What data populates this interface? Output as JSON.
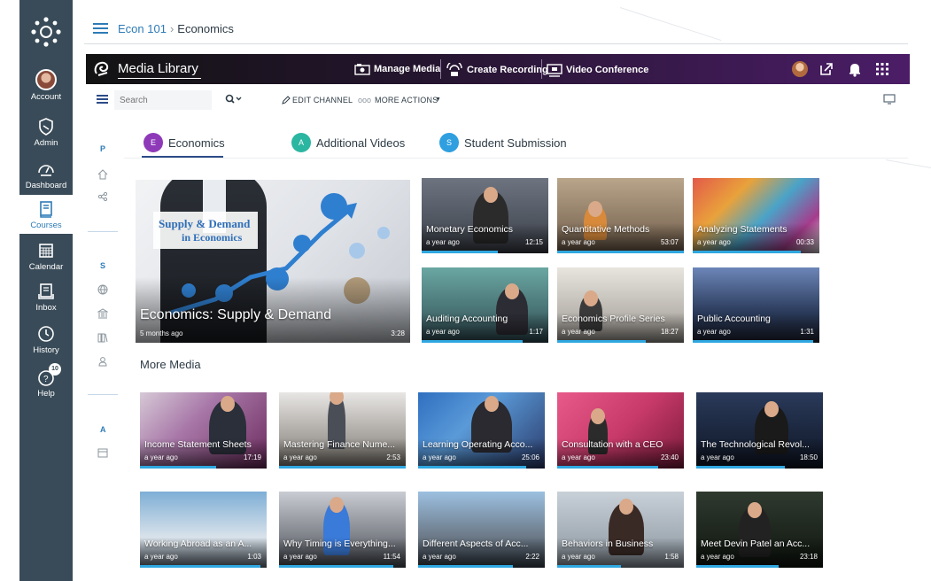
{
  "global_nav": {
    "items": [
      {
        "label": "Account",
        "icon": "avatar"
      },
      {
        "label": "Admin",
        "icon": "shield-icon"
      },
      {
        "label": "Dashboard",
        "icon": "dashboard-icon"
      },
      {
        "label": "Courses",
        "icon": "book-icon"
      },
      {
        "label": "Calendar",
        "icon": "calendar-icon"
      },
      {
        "label": "Inbox",
        "icon": "inbox-icon"
      },
      {
        "label": "History",
        "icon": "clock-icon"
      },
      {
        "label": "Help",
        "icon": "help-icon",
        "badge": "10"
      }
    ],
    "background": "#394b58"
  },
  "breadcrumb": {
    "course": "Econ 101",
    "page": "Economics"
  },
  "header": {
    "title": "Media Library",
    "actions": [
      "Manage Media",
      "Create Recording",
      "Video Conference"
    ]
  },
  "toolbar": {
    "search_placeholder": "Search",
    "edit_channel": "EDIT CHANNEL",
    "more_actions": "MORE ACTIONS"
  },
  "rail": {
    "letters": [
      "P",
      "S",
      "A"
    ]
  },
  "tabs": [
    {
      "label": "Economics",
      "initial": "E",
      "color": "#8e3ab8"
    },
    {
      "label": "Additional Videos",
      "initial": "A",
      "color": "#2bb6a1"
    },
    {
      "label": "Student Submission",
      "initial": "S",
      "color": "#2f9fe0"
    }
  ],
  "featured": {
    "overlay_line1": "Supply & Demand",
    "overlay_line2": "in Economics",
    "title": "Economics: Supply & Demand",
    "meta": "5 months ago",
    "duration": "3:28"
  },
  "grid": [
    {
      "title": "Monetary Economics",
      "meta": "a year ago",
      "duration": "12:15"
    },
    {
      "title": "Quantitative Methods",
      "meta": "a year ago",
      "duration": "53:07"
    },
    {
      "title": "Analyzing Statements",
      "meta": "a year ago",
      "duration": "00:33"
    },
    {
      "title": "Auditing Accounting",
      "meta": "a year ago",
      "duration": "1:17"
    },
    {
      "title": "Economics Profile Series",
      "meta": "a year ago",
      "duration": "18:27"
    },
    {
      "title": "Public Accounting",
      "meta": "a year ago",
      "duration": "1:31"
    }
  ],
  "more_media_title": "More Media",
  "more_media": [
    {
      "title": "Income Statement Sheets",
      "meta": "a year ago",
      "duration": "17:19"
    },
    {
      "title": "Mastering Finance Nume...",
      "meta": "a year ago",
      "duration": "2:53"
    },
    {
      "title": "Learning Operating Acco...",
      "meta": "a year ago",
      "duration": "25:06"
    },
    {
      "title": "Consultation with a CEO",
      "meta": "a year ago",
      "duration": "23:40"
    },
    {
      "title": "The Technological Revol...",
      "meta": "a year ago",
      "duration": "18:50"
    },
    {
      "title": "Working Abroad as an A...",
      "meta": "a year ago",
      "duration": "1:03"
    },
    {
      "title": "Why Timing is Everything...",
      "meta": "a year ago",
      "duration": "11:54"
    },
    {
      "title": "Different Aspects of Acc...",
      "meta": "a year ago",
      "duration": "2:22"
    },
    {
      "title": "Behaviors in Business",
      "meta": "a year ago",
      "duration": "1:58"
    },
    {
      "title": "Meet Devin Patel an Acc...",
      "meta": "a year ago",
      "duration": "23:18"
    }
  ],
  "colors": {
    "accent": "#2d7bb6",
    "header_purple": "#4b1d67",
    "progress": "#2fa7e0"
  }
}
